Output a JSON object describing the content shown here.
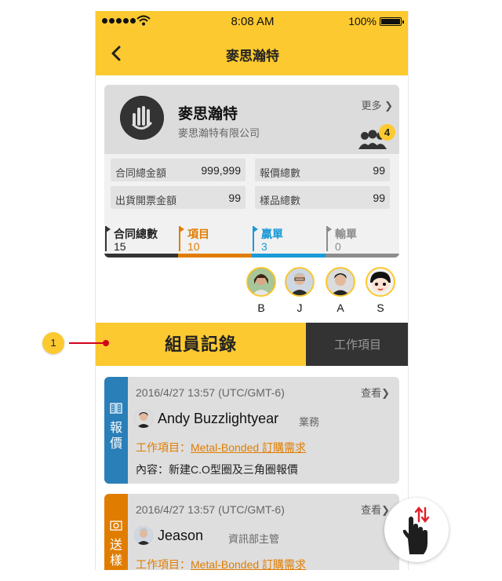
{
  "status_bar": {
    "time": "8:08 AM",
    "battery": "100%"
  },
  "nav": {
    "title": "麥思瀚特"
  },
  "profile": {
    "name": "麥思瀚特",
    "company": "麥思瀚特有限公司",
    "more": "更多",
    "group_count": "4"
  },
  "stats": [
    {
      "label": "合同總金額",
      "value": "999,999"
    },
    {
      "label": "報價總數",
      "value": "99"
    },
    {
      "label": "出貨開票金額",
      "value": "99"
    },
    {
      "label": "樣品總數",
      "value": "99"
    }
  ],
  "pipeline": [
    {
      "label": "合同總數",
      "value": "15",
      "color": "#333333"
    },
    {
      "label": "項目",
      "value": "10",
      "color": "#e07d00"
    },
    {
      "label": "贏單",
      "value": "3",
      "color": "#1a9ad6"
    },
    {
      "label": "輸單",
      "value": "0",
      "color": "#8c8c8c"
    }
  ],
  "members": [
    "B",
    "J",
    "A",
    "S"
  ],
  "segment": {
    "active": "組員記錄",
    "inactive": "工作項目"
  },
  "records": [
    {
      "type": "報價",
      "color": "#2a7fb8",
      "time": "2016/4/27 13:57 (UTC/GMT-6)",
      "view": "查看",
      "user": "Andy Buzzlightyear",
      "role": "業務",
      "task_label": "工作項目：",
      "task_link": "Metal-Bonded 訂購需求",
      "content": "內容：新建C.O型圈及三角圈報價"
    },
    {
      "type": "送樣",
      "color": "#e07d00",
      "time": "2016/4/27 13:57 (UTC/GMT-6)",
      "view": "查看",
      "user": "Jeason",
      "role": "資訊部主管",
      "task_label": "工作項目：",
      "task_link": "Metal-Bonded 訂購需求"
    }
  ],
  "annotation": {
    "number": "1"
  }
}
